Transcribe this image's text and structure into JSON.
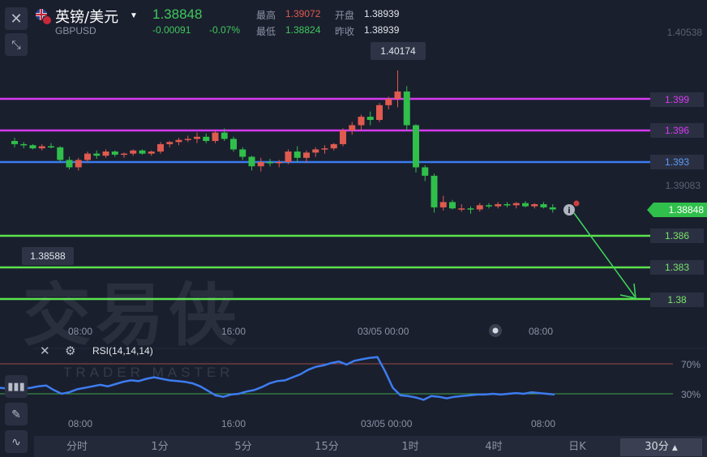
{
  "header": {
    "pair_name": "英镑/美元",
    "pair_code": "GBPUSD",
    "price": "1.38848",
    "change": "-0.00091",
    "change_pct": "-0.07%",
    "high_label": "最高",
    "high_value": "1.39072",
    "open_label": "开盘",
    "open_value": "1.38939",
    "low_label": "最低",
    "low_value": "1.38824",
    "prev_label": "昨收",
    "prev_value": "1.38939"
  },
  "price_axis": {
    "top_label": "1.40538",
    "mid_label": "1.39083",
    "current_price": "1.38848"
  },
  "levels": [
    {
      "label": "1.399",
      "color": "#d63bf0"
    },
    {
      "label": "1.396",
      "color": "#d63bf0"
    },
    {
      "label": "1.393",
      "color": "#3b7cf0"
    },
    {
      "label": "1.386",
      "color": "#5be34d"
    },
    {
      "label": "1.383",
      "color": "#5be34d"
    },
    {
      "label": "1.38",
      "color": "#5be34d"
    }
  ],
  "callouts": {
    "peak": "1.40174",
    "trough": "1.38588"
  },
  "time_axis": [
    "08:00",
    "16:00",
    "03/05 00:00",
    "08:00"
  ],
  "rsi": {
    "label": "RSI(14,14,14)",
    "upper": "70%",
    "lower": "30%"
  },
  "watermark": {
    "cn": "交易侠",
    "en": "TRADER MASTER"
  },
  "timeframes": [
    "分时",
    "1分",
    "5分",
    "15分",
    "1时",
    "4时",
    "日K",
    "30分"
  ],
  "active_timeframe": "30分",
  "colors": {
    "up": "#e05a4f",
    "down": "#2fbf4a",
    "bg": "#1a1f2e"
  },
  "chart_data": {
    "type": "candlestick",
    "y_axis": [
      1.375,
      1.406
    ],
    "candles": [
      [
        1.395,
        1.3953,
        1.3944,
        1.3947
      ],
      [
        1.3947,
        1.3949,
        1.3943,
        1.3946
      ],
      [
        1.3946,
        1.3947,
        1.3942,
        1.3943
      ],
      [
        1.3943,
        1.3947,
        1.3941,
        1.3945
      ],
      [
        1.3945,
        1.3948,
        1.3943,
        1.3944
      ],
      [
        1.3944,
        1.3945,
        1.393,
        1.3932
      ],
      [
        1.3932,
        1.3935,
        1.3923,
        1.3925
      ],
      [
        1.3925,
        1.3934,
        1.3922,
        1.3932
      ],
      [
        1.3932,
        1.394,
        1.393,
        1.3938
      ],
      [
        1.3938,
        1.3941,
        1.3933,
        1.3936
      ],
      [
        1.3936,
        1.3942,
        1.3934,
        1.394
      ],
      [
        1.394,
        1.3941,
        1.3935,
        1.3937
      ],
      [
        1.3937,
        1.3939,
        1.3934,
        1.3938
      ],
      [
        1.3938,
        1.3942,
        1.3936,
        1.3941
      ],
      [
        1.3941,
        1.3942,
        1.3937,
        1.3938
      ],
      [
        1.3938,
        1.3941,
        1.3936,
        1.394
      ],
      [
        1.394,
        1.3949,
        1.3938,
        1.3947
      ],
      [
        1.3947,
        1.395,
        1.3944,
        1.3949
      ],
      [
        1.3949,
        1.3953,
        1.3946,
        1.3951
      ],
      [
        1.3951,
        1.3955,
        1.3949,
        1.3952
      ],
      [
        1.3952,
        1.3958,
        1.3948,
        1.3954
      ],
      [
        1.3954,
        1.3957,
        1.3948,
        1.395
      ],
      [
        1.395,
        1.396,
        1.3948,
        1.3958
      ],
      [
        1.3958,
        1.3962,
        1.395,
        1.3952
      ],
      [
        1.3952,
        1.3954,
        1.394,
        1.3942
      ],
      [
        1.3942,
        1.3944,
        1.3932,
        1.3935
      ],
      [
        1.3935,
        1.3936,
        1.3922,
        1.3926
      ],
      [
        1.3926,
        1.3934,
        1.3921,
        1.393
      ],
      [
        1.393,
        1.3933,
        1.3926,
        1.3929
      ],
      [
        1.3929,
        1.3932,
        1.3925,
        1.393
      ],
      [
        1.393,
        1.3942,
        1.3928,
        1.394
      ],
      [
        1.394,
        1.3945,
        1.393,
        1.3934
      ],
      [
        1.3934,
        1.3941,
        1.3929,
        1.3939
      ],
      [
        1.3939,
        1.3944,
        1.3935,
        1.3942
      ],
      [
        1.3942,
        1.3946,
        1.3938,
        1.3943
      ],
      [
        1.3943,
        1.3948,
        1.3941,
        1.3947
      ],
      [
        1.3947,
        1.3962,
        1.3945,
        1.396
      ],
      [
        1.396,
        1.3968,
        1.3956,
        1.3965
      ],
      [
        1.3965,
        1.3975,
        1.396,
        1.3973
      ],
      [
        1.3973,
        1.3978,
        1.3965,
        1.397
      ],
      [
        1.397,
        1.3986,
        1.3968,
        1.3984
      ],
      [
        1.3984,
        1.3992,
        1.398,
        1.399
      ],
      [
        1.399,
        1.4017,
        1.3982,
        1.3997
      ],
      [
        1.3997,
        1.4002,
        1.396,
        1.3965
      ],
      [
        1.3965,
        1.3966,
        1.392,
        1.3925
      ],
      [
        1.3925,
        1.3927,
        1.3912,
        1.3917
      ],
      [
        1.3917,
        1.3919,
        1.3882,
        1.3887
      ],
      [
        1.3887,
        1.3898,
        1.3884,
        1.3892
      ],
      [
        1.3892,
        1.3894,
        1.3885,
        1.3886
      ],
      [
        1.3886,
        1.389,
        1.3883,
        1.3886
      ],
      [
        1.3886,
        1.3888,
        1.3881,
        1.3885
      ],
      [
        1.3885,
        1.3891,
        1.3883,
        1.3889
      ],
      [
        1.3889,
        1.3891,
        1.3886,
        1.3888
      ],
      [
        1.3888,
        1.3892,
        1.3886,
        1.389
      ],
      [
        1.389,
        1.3892,
        1.3887,
        1.3889
      ],
      [
        1.3889,
        1.3892,
        1.3886,
        1.3891
      ],
      [
        1.3891,
        1.3893,
        1.3887,
        1.3888
      ],
      [
        1.3888,
        1.3891,
        1.3886,
        1.389
      ],
      [
        1.389,
        1.3892,
        1.3886,
        1.3887
      ],
      [
        1.3887,
        1.389,
        1.3882,
        1.3885
      ]
    ],
    "rsi_values": [
      38,
      37,
      36,
      37,
      38,
      40,
      41,
      35,
      30,
      32,
      36,
      38,
      40,
      42,
      40,
      43,
      46,
      48,
      47,
      50,
      52,
      50,
      48,
      47,
      46,
      44,
      40,
      34,
      28,
      26,
      29,
      30,
      33,
      35,
      39,
      44,
      47,
      48,
      52,
      56,
      62,
      66,
      68,
      71,
      73,
      69,
      74,
      76,
      78,
      79,
      60,
      38,
      28,
      27,
      25,
      22,
      27,
      26,
      24,
      26,
      27,
      28,
      29,
      29,
      30,
      29,
      30,
      31,
      30,
      32,
      31,
      30,
      29
    ]
  }
}
